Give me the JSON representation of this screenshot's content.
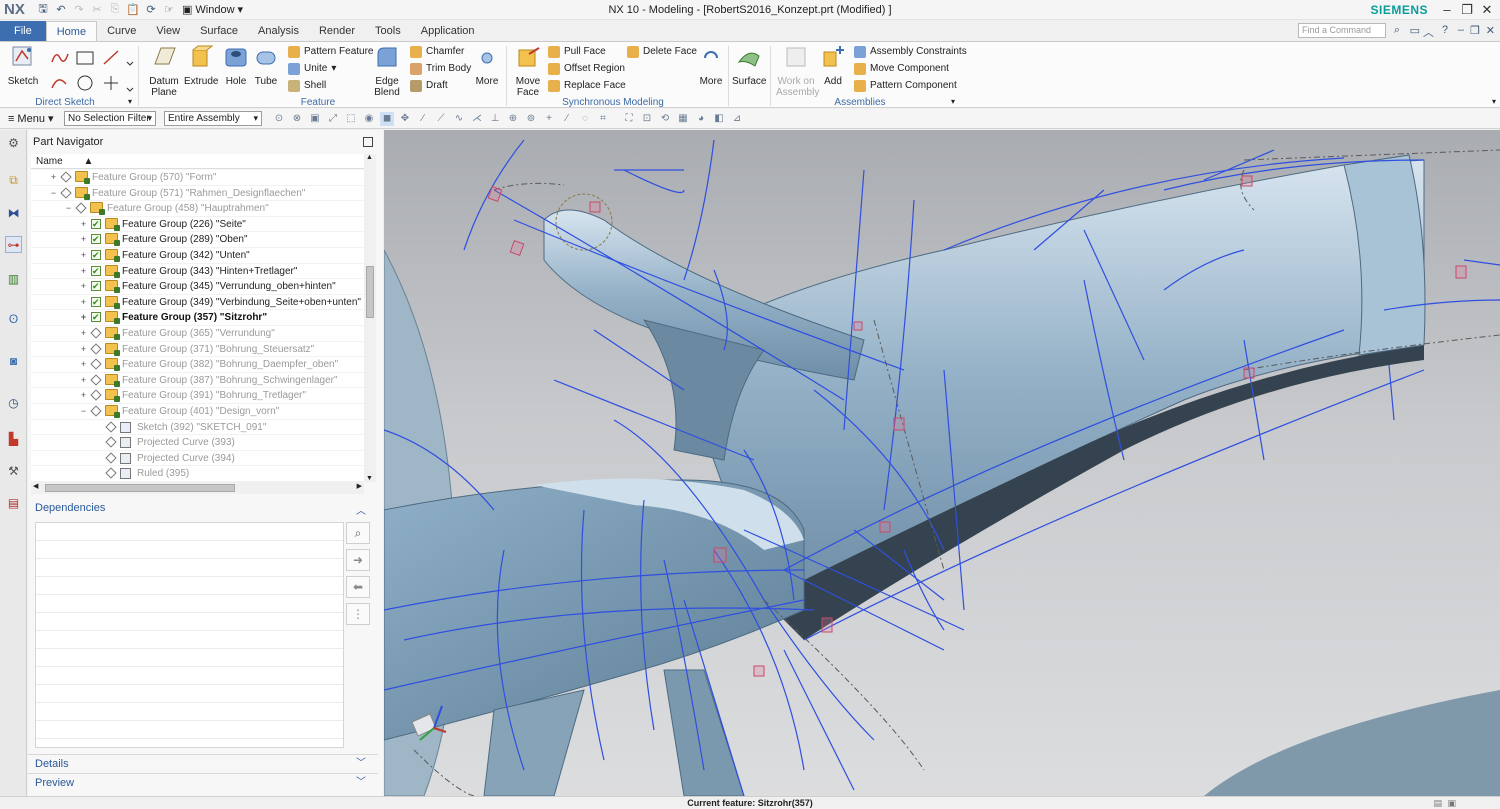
{
  "window": {
    "app_logo": "NX",
    "window_menu": "Window",
    "title": "NX 10 - Modeling - [RobertS2016_Konzept.prt (Modified) ]",
    "brand": "SIEMENS"
  },
  "tabs": [
    "File",
    "Home",
    "Curve",
    "View",
    "Surface",
    "Analysis",
    "Render",
    "Tools",
    "Application"
  ],
  "active_tab": "Home",
  "search": {
    "placeholder": "Find a Command"
  },
  "ribbon": {
    "direct_sketch": {
      "label": "Direct Sketch",
      "sketch": "Sketch"
    },
    "feature": {
      "label": "Feature",
      "datum_plane": [
        "Datum",
        "Plane"
      ],
      "extrude": "Extrude",
      "hole": "Hole",
      "tube": "Tube",
      "pattern_feature": "Pattern Feature",
      "unite": "Unite",
      "shell": "Shell",
      "edge_blend": [
        "Edge",
        "Blend"
      ],
      "chamfer": "Chamfer",
      "trim_body": "Trim Body",
      "draft": "Draft",
      "more": "More"
    },
    "synchronous": {
      "label": "Synchronous Modeling",
      "move_face": [
        "Move",
        "Face"
      ],
      "pull_face": "Pull Face",
      "offset_region": "Offset Region",
      "replace_face": "Replace Face",
      "delete_face": "Delete Face",
      "more": "More"
    },
    "surface": {
      "label": "Surface"
    },
    "assemblies": {
      "label": "Assemblies",
      "work_on_assembly": [
        "Work on",
        "Assembly"
      ],
      "add": "Add",
      "assembly_constraints": "Assembly Constraints",
      "move_component": "Move Component",
      "pattern_component": "Pattern Component"
    }
  },
  "toolbar": {
    "menu": "Menu",
    "selection_filter": "No Selection Filter",
    "scope": "Entire Assembly"
  },
  "navigator": {
    "title": "Part Navigator",
    "column_name": "Name",
    "rows": [
      {
        "text": "Feature Group (570) \"Form\"",
        "state": "dim",
        "indent": 0,
        "check": false,
        "toggle": "+"
      },
      {
        "text": "Feature Group (571) \"Rahmen_Designflaechen\"",
        "state": "dim",
        "indent": 0,
        "check": false,
        "toggle": "−"
      },
      {
        "text": "Feature Group (458) \"Hauptrahmen\"",
        "state": "dim",
        "indent": 1,
        "check": false,
        "toggle": "−"
      },
      {
        "text": "Feature Group (226) \"Seite\"",
        "state": "normal",
        "indent": 2,
        "check": true,
        "toggle": "+"
      },
      {
        "text": "Feature Group (289) \"Oben\"",
        "state": "normal",
        "indent": 2,
        "check": true,
        "toggle": "+"
      },
      {
        "text": "Feature Group (342) \"Unten\"",
        "state": "normal",
        "indent": 2,
        "check": true,
        "toggle": "+"
      },
      {
        "text": "Feature Group (343) \"Hinten+Tretlager\"",
        "state": "normal",
        "indent": 2,
        "check": true,
        "toggle": "+"
      },
      {
        "text": "Feature Group (345) \"Verrundung_oben+hinten\"",
        "state": "normal",
        "indent": 2,
        "check": true,
        "toggle": "+"
      },
      {
        "text": "Feature Group (349) \"Verbindung_Seite+oben+unten\"",
        "state": "normal",
        "indent": 2,
        "check": true,
        "toggle": "+"
      },
      {
        "text": "Feature Group (357) \"Sitzrohr\"",
        "state": "bold",
        "indent": 2,
        "check": true,
        "toggle": "+"
      },
      {
        "text": "Feature Group (365) \"Verrundung\"",
        "state": "dim",
        "indent": 2,
        "check": false,
        "toggle": "+"
      },
      {
        "text": "Feature Group (371) \"Bohrung_Steuersatz\"",
        "state": "dim",
        "indent": 2,
        "check": false,
        "toggle": "+"
      },
      {
        "text": "Feature Group (382) \"Bohrung_Daempfer_oben\"",
        "state": "dim",
        "indent": 2,
        "check": false,
        "toggle": "+"
      },
      {
        "text": "Feature Group (387) \"Bohrung_Schwingenlager\"",
        "state": "dim",
        "indent": 2,
        "check": false,
        "toggle": "+"
      },
      {
        "text": "Feature Group (391) \"Bohrung_Tretlager\"",
        "state": "dim",
        "indent": 2,
        "check": false,
        "toggle": "+"
      },
      {
        "text": "Feature Group (401) \"Design_vorn\"",
        "state": "dim",
        "indent": 2,
        "check": false,
        "toggle": "−"
      },
      {
        "text": "Sketch (392) \"SKETCH_091\"",
        "state": "dim",
        "indent": 3,
        "check": false,
        "toggle": ""
      },
      {
        "text": "Projected Curve (393)",
        "state": "dim",
        "indent": 3,
        "check": false,
        "toggle": ""
      },
      {
        "text": "Projected Curve (394)",
        "state": "dim",
        "indent": 3,
        "check": false,
        "toggle": ""
      },
      {
        "text": "Ruled (395)",
        "state": "dim",
        "indent": 3,
        "check": false,
        "toggle": ""
      }
    ]
  },
  "panels": {
    "dependencies": "Dependencies",
    "details": "Details",
    "preview": "Preview"
  },
  "status": {
    "current_feature": "Current feature: Sitzrohr(357)"
  },
  "colors": {
    "accent": "#3d6fb0",
    "label_blue": "#3a6aa6",
    "brand": "#0a9d9a",
    "curve_blue": "#2f4fe0"
  }
}
